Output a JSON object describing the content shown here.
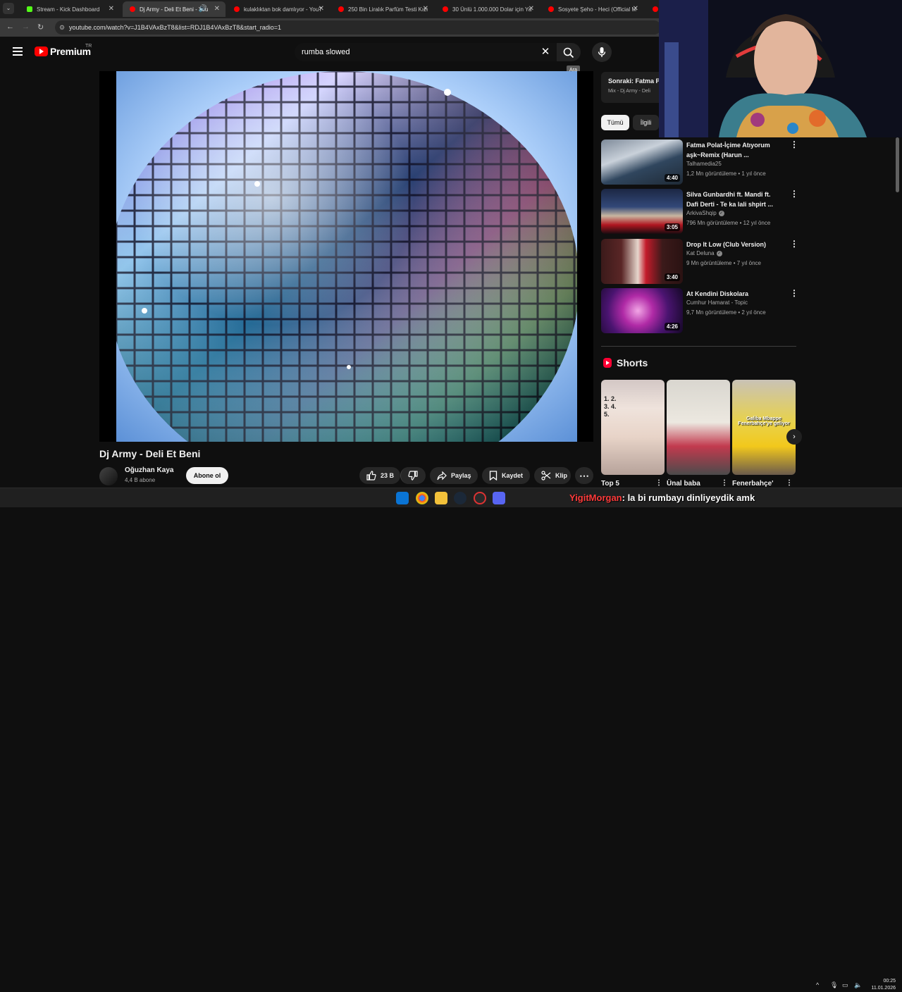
{
  "browser": {
    "tabs": [
      {
        "title": "Stream - Kick Dashboard",
        "color": "#53fc18"
      },
      {
        "title": "Dj Army - Deli Et Beni - You",
        "color": "#ff0000"
      },
      {
        "title": "kulaklıktan bok damlıyor - YouT",
        "color": "#ff0000"
      },
      {
        "title": "250 Bin Liralık Parfüm Testi Kızı",
        "color": "#ff0000"
      },
      {
        "title": "30 Ünlü 1.000.000 Dolar için Ya",
        "color": "#ff0000"
      },
      {
        "title": "Sosyete Şeho - Heci (Official M",
        "color": "#ff0000"
      }
    ],
    "url": "youtube.com/watch?v=J1B4VAxBzT8&list=RDJ1B4VAxBzT8&start_radio=1"
  },
  "header": {
    "logo_text": "Premium",
    "country_code": "TR",
    "search_value": "rumba slowed",
    "tooltip": "Ara"
  },
  "video": {
    "title": "Dj Army - Deli Et Beni",
    "channel": "Oğuzhan Kaya",
    "subscribers": "4,4 B abone",
    "subscribe_label": "Abone ol",
    "likes": "23 B",
    "share_label": "Paylaş",
    "save_label": "Kaydet",
    "clip_label": "Klip"
  },
  "sidebar": {
    "next": {
      "title": "Sonraki: Fatma P",
      "subtitle": "Mix - Dj Army - Deli"
    },
    "chips": [
      "Tümü",
      "İlgili"
    ],
    "recommendations": [
      {
        "title": "Fatma Polat-İçime Atıyorum aşk~Remix (Harun ...",
        "channel": "Talhamedia25",
        "verified": false,
        "meta": "1,2 Mn görüntüleme • 1 yıl önce",
        "duration": "4:40"
      },
      {
        "title": "Silva Gunbardhi ft. Mandi ft. Dafi Derti - Te ka lali shpirt ...",
        "channel": "ArkivaShqip",
        "verified": true,
        "meta": "796 Mn görüntüleme • 12 yıl önce",
        "duration": "3:05"
      },
      {
        "title": "Drop It Low (Club Version)",
        "channel": "Kat Deluna",
        "verified": true,
        "meta": "9 Mn görüntüleme • 7 yıl önce",
        "duration": "3:40"
      },
      {
        "title": "At Kendini Diskolara",
        "channel": "Cumhur Hamarat - Topic",
        "verified": false,
        "meta": "9,7 Mn görüntüleme • 2 yıl önce",
        "duration": "4:26"
      }
    ],
    "shorts_label": "Shorts",
    "shorts": [
      {
        "title": "Top 5"
      },
      {
        "title": "Ünal baba"
      },
      {
        "title": "Fenerbahçe'"
      }
    ],
    "shorts_overlay_1": "1. 2. 3. 4. 5.",
    "shorts_overlay_3": "Galiba Mbappe Fenerbahçe'ye geliyor"
  },
  "overlay": {
    "chat_user": "YigitMorgan",
    "chat_text": ": la bi rumbayı dinliyeydik amk"
  },
  "taskbar": {
    "time": "00:25",
    "date": "11.01.2026"
  }
}
